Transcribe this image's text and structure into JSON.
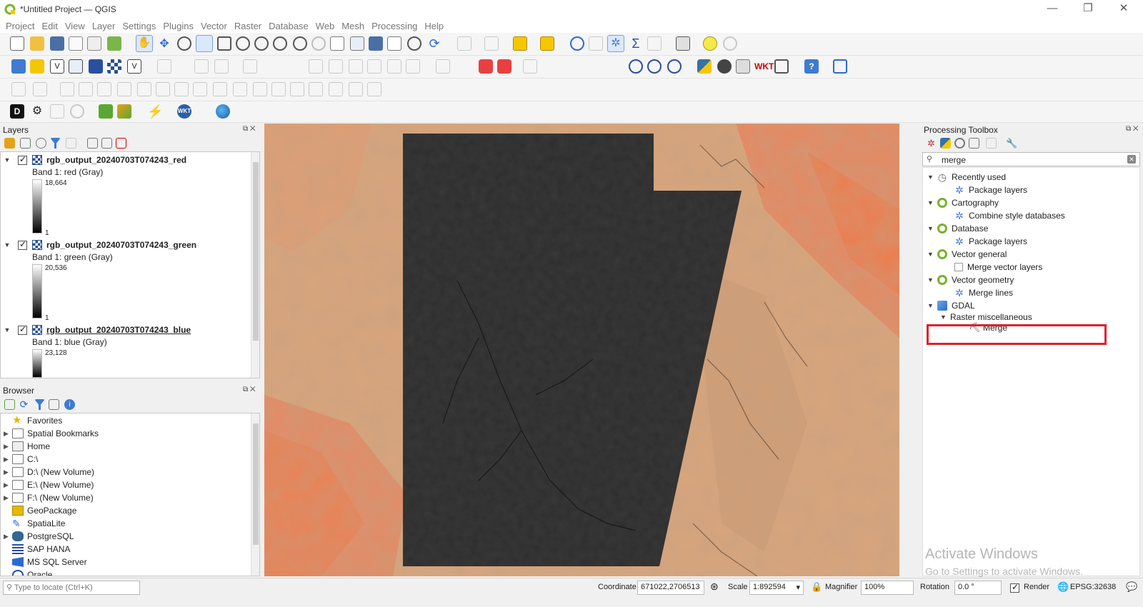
{
  "window": {
    "title": "*Untitled Project — QGIS",
    "controls": {
      "minimize": "—",
      "restore": "❐",
      "close": "✕"
    }
  },
  "menu": [
    "Project",
    "Edit",
    "View",
    "Layer",
    "Settings",
    "Plugins",
    "Vector",
    "Raster",
    "Database",
    "Web",
    "Mesh",
    "Processing",
    "Help"
  ],
  "layers_panel": {
    "title": "Layers",
    "layers": [
      {
        "name": "rgb_output_20240703T074243_red",
        "band": "Band 1: red (Gray)",
        "max": "18,664",
        "min": "1"
      },
      {
        "name": "rgb_output_20240703T074243_green",
        "band": "Band 1: green (Gray)",
        "max": "20,536",
        "min": "1"
      },
      {
        "name": "rgb_output_20240703T074243_blue",
        "band": "Band 1: blue (Gray)",
        "max": "23,128",
        "min": ""
      }
    ]
  },
  "browser_panel": {
    "title": "Browser",
    "items": [
      "Favorites",
      "Spatial Bookmarks",
      "Home",
      "C:\\",
      "D:\\ (New Volume)",
      "E:\\ (New Volume)",
      "F:\\ (New Volume)",
      "GeoPackage",
      "SpatiaLite",
      "PostgreSQL",
      "SAP HANA",
      "MS SQL Server",
      "Oracle"
    ]
  },
  "toolbox": {
    "title": "Processing Toolbox",
    "search_value": "merge",
    "groups": [
      {
        "name": "Recently used",
        "items": [
          "Package layers"
        ]
      },
      {
        "name": "Cartography",
        "items": [
          "Combine style databases"
        ]
      },
      {
        "name": "Database",
        "items": [
          "Package layers"
        ]
      },
      {
        "name": "Vector general",
        "items": [
          "Merge vector layers"
        ]
      },
      {
        "name": "Vector geometry",
        "items": [
          "Merge lines"
        ]
      },
      {
        "name": "GDAL",
        "subgroup": "Raster miscellaneous",
        "items": [
          "Merge"
        ]
      }
    ],
    "highlight_color": "#e0202a"
  },
  "watermark": {
    "line1": "Activate Windows",
    "line2": "Go to Settings to activate Windows."
  },
  "statusbar": {
    "locate_placeholder": "Type to locate (Ctrl+K)",
    "coordinate_label": "Coordinate",
    "coordinate": "671022,2706513",
    "scale_label": "Scale",
    "scale": "1:892594",
    "magnifier_label": "Magnifier",
    "magnifier": "100%",
    "rotation_label": "Rotation",
    "rotation": "0.0 °",
    "render_label": "Render",
    "crs": "EPSG:32638"
  },
  "colors": {
    "desert": "#d9a57c",
    "desert_red": "#e8825c",
    "raster_dark": "#2e2e2e",
    "qgis_green": "#78b22f"
  }
}
